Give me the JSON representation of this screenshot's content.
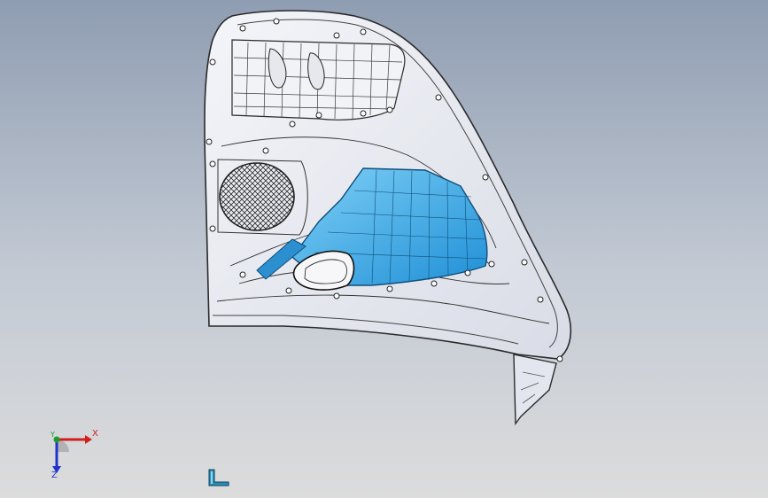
{
  "viewport": {
    "background_top": "#8f9db2",
    "background_bottom": "#dcdcdc",
    "model_fill": "#e9ebf1",
    "model_outline": "#2a2a2a",
    "highlight_fill": "#3aa9e8",
    "highlight_light": "#7fd0f6"
  },
  "triad": {
    "x_label": "X",
    "y_label": "Y",
    "z_label": "Z",
    "x_color": "#d21e1e",
    "y_color": "#1e9a2c",
    "z_color": "#2233cc"
  },
  "part_icon": {
    "name": "part-icon",
    "color": "#2a8fb8"
  }
}
